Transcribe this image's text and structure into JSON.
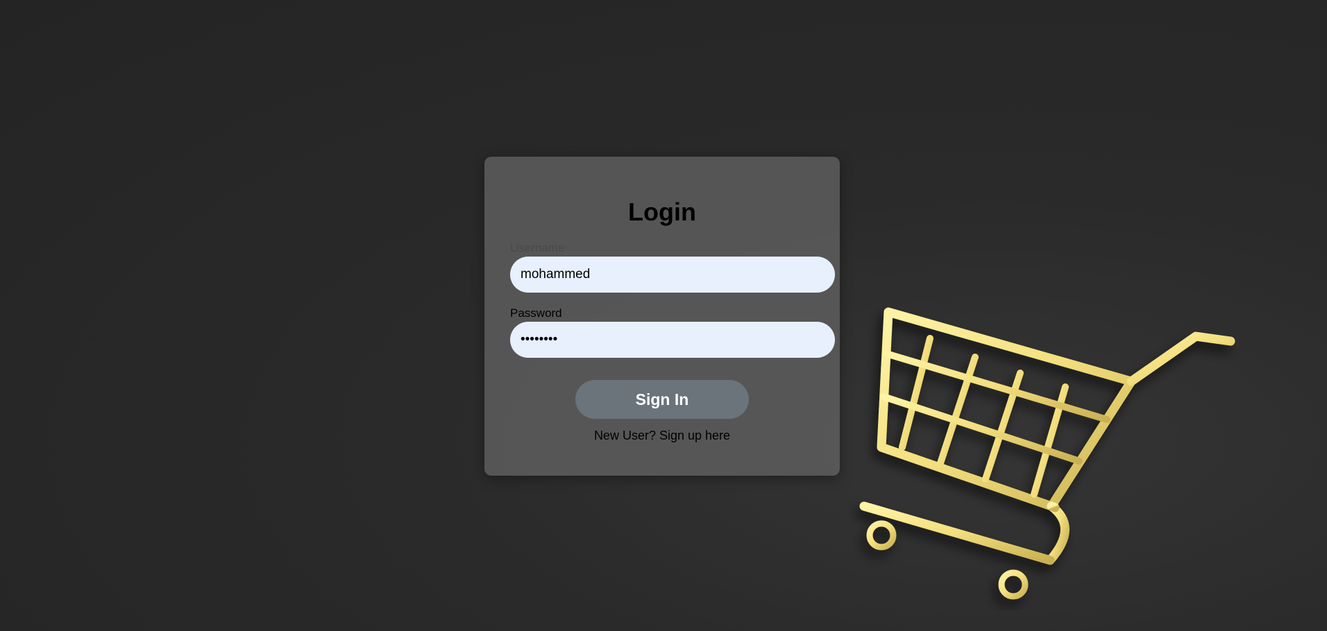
{
  "login": {
    "title": "Login",
    "username_label": "Username",
    "username_value": "mohammed",
    "password_label": "Password",
    "password_value": "••••••••",
    "signin_label": "Sign In",
    "signup_text": "New User? Sign up here"
  },
  "theme": {
    "background": "#262626",
    "card": "#5a5a5a",
    "input_bg": "#e8f0fe",
    "button_bg": "#6b737b",
    "cart_color": "#f2de7c"
  },
  "illustration": {
    "icon": "shopping-cart-icon"
  }
}
